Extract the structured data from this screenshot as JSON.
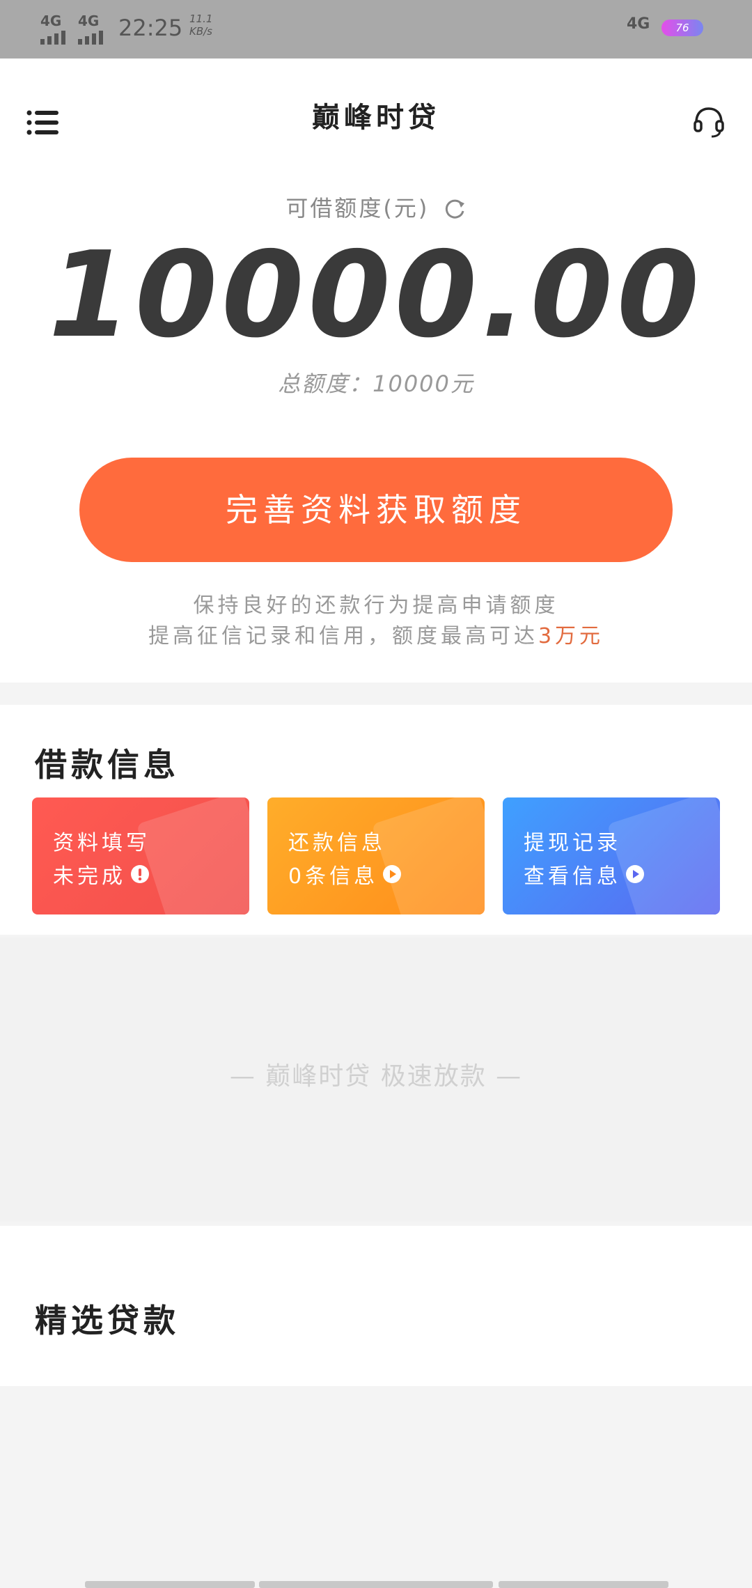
{
  "status_bar": {
    "signal1": "4G",
    "signal2": "4G",
    "time": "22:25",
    "speed_value": "11.1",
    "speed_unit": "KB/s",
    "network_right": "4G",
    "battery": "76"
  },
  "header": {
    "title": "巅峰时贷",
    "menu_icon": "menu-list-icon",
    "support_icon": "headset-icon"
  },
  "credit": {
    "available_label": "可借额度(元)",
    "amount": "10000.00",
    "total_label": "总额度：10000元"
  },
  "cta": {
    "label": "完善资料获取额度",
    "color": "#ff6b3d"
  },
  "tips": {
    "line1": "保持良好的还款行为提高申请额度",
    "line2_prefix": "提高征信记录和信用，额度最高可达",
    "line2_highlight": "3万元"
  },
  "borrow_info": {
    "title": "借款信息",
    "cards": [
      {
        "line1": "资料填写",
        "line2": "未完成",
        "icon": "exclamation-icon",
        "color": "#f2504c"
      },
      {
        "line1": "还款信息",
        "line2": "0条信息",
        "icon": "play-circle-icon",
        "color": "#ff8c1a"
      },
      {
        "line1": "提现记录",
        "line2": "查看信息",
        "icon": "play-circle-icon",
        "color": "#5b67f0"
      }
    ]
  },
  "banner": {
    "text": "— 巅峰时贷  极速放款 —"
  },
  "featured": {
    "title": "精选贷款"
  }
}
